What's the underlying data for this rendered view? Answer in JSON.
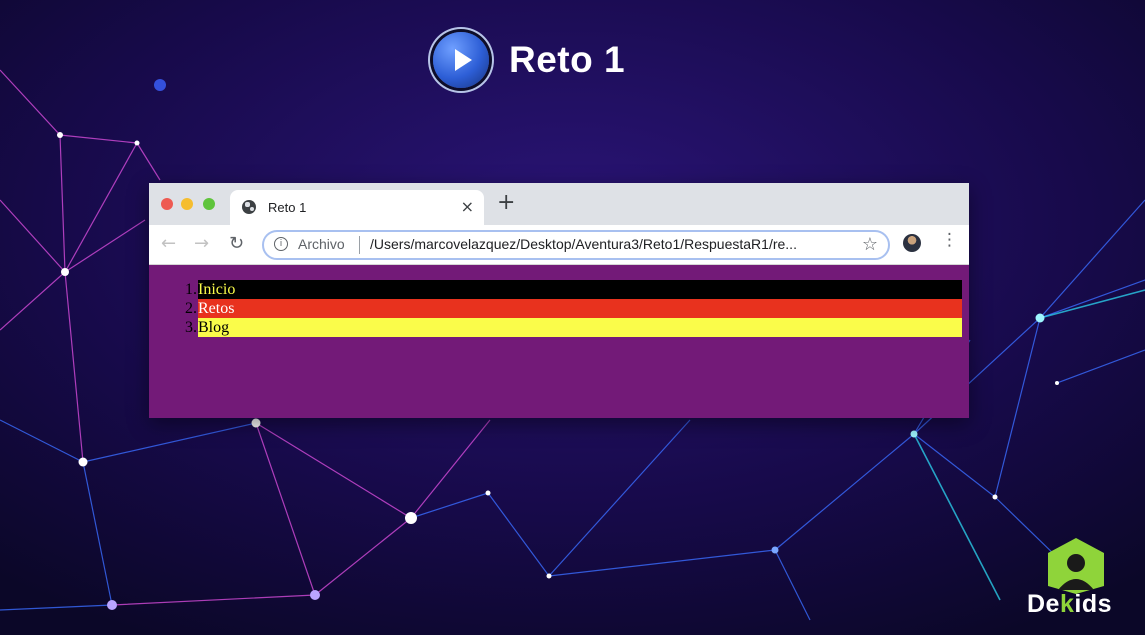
{
  "slide": {
    "title": "Reto 1"
  },
  "browser": {
    "tab": {
      "title": "Reto 1",
      "close": "×"
    },
    "new_tab": "+",
    "toolbar": {
      "back": "←",
      "forward": "→",
      "reload": "↻",
      "security_label": "Archivo",
      "url": "/Users/marcovelazquez/Desktop/Aventura3/Reto1/RespuestaR1/re...",
      "bookmark": "☆",
      "menu": "⋮"
    }
  },
  "list": {
    "items": [
      {
        "number": "1.",
        "label": "Inicio",
        "bg": "#000000",
        "fg": "#fafc4a"
      },
      {
        "number": "2.",
        "label": "Retos",
        "bg": "#e8321e",
        "fg": "#ffffff"
      },
      {
        "number": "3.",
        "label": "Blog",
        "bg": "#fafc4a",
        "fg": "#000000"
      }
    ]
  },
  "page_bg": "#731a78",
  "brand": {
    "name_a": "De",
    "name_k": "k",
    "name_b": "ids",
    "accent": "#8fd43a"
  }
}
